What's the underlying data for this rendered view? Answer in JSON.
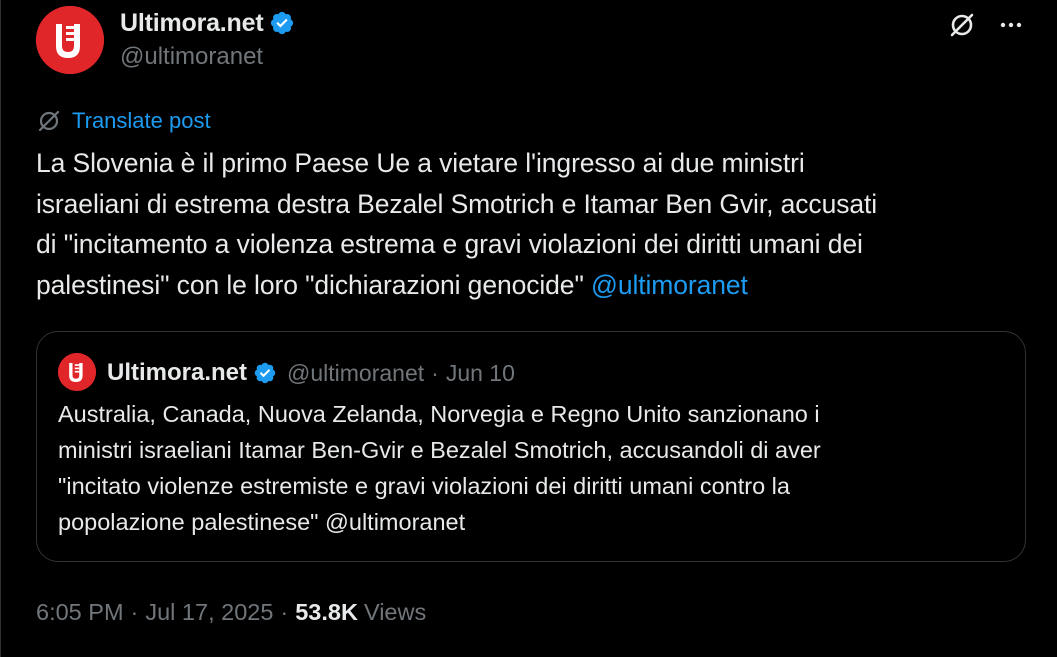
{
  "author": {
    "name": "Ultimora.net",
    "handle": "@ultimoranet",
    "verified": true,
    "avatar_color": "#e1262a"
  },
  "header_actions": {
    "grok_icon": "grok-icon",
    "more_icon": "more-icon"
  },
  "translate": {
    "label": "Translate post",
    "icon": "translate-icon"
  },
  "post": {
    "text_lines": [
      "La Slovenia è il primo Paese Ue a vietare l'ingresso ai due ministri",
      "israeliani di estrema destra Bezalel Smotrich e Itamar Ben Gvir, accusati",
      "di \"incitamento a violenza estrema e gravi violazioni dei diritti umani dei",
      "palestinesi\" con le loro \"dichiarazioni genocide\" "
    ],
    "mention": "@ultimoranet"
  },
  "quote": {
    "name": "Ultimora.net",
    "handle": "@ultimoranet",
    "separator": "·",
    "date": "Jun 10",
    "text_lines": [
      "Australia, Canada, Nuova Zelanda, Norvegia e Regno Unito sanzionano i",
      "ministri israeliani Itamar Ben-Gvir e Bezalel Smotrich, accusandoli di aver",
      "\"incitato violenze estremiste e gravi violazioni dei diritti umani contro la",
      "popolazione palestinese\" @ultimoranet"
    ]
  },
  "meta": {
    "time": "6:05 PM",
    "separator": "·",
    "date": "Jul 17, 2025",
    "views_count": "53.8K",
    "views_label": "Views"
  },
  "colors": {
    "background": "#000000",
    "text_primary": "#e7e9ea",
    "text_secondary": "#71767b",
    "accent": "#1d9bf0",
    "border": "#2f3336",
    "verified": "#1d9bf0"
  }
}
